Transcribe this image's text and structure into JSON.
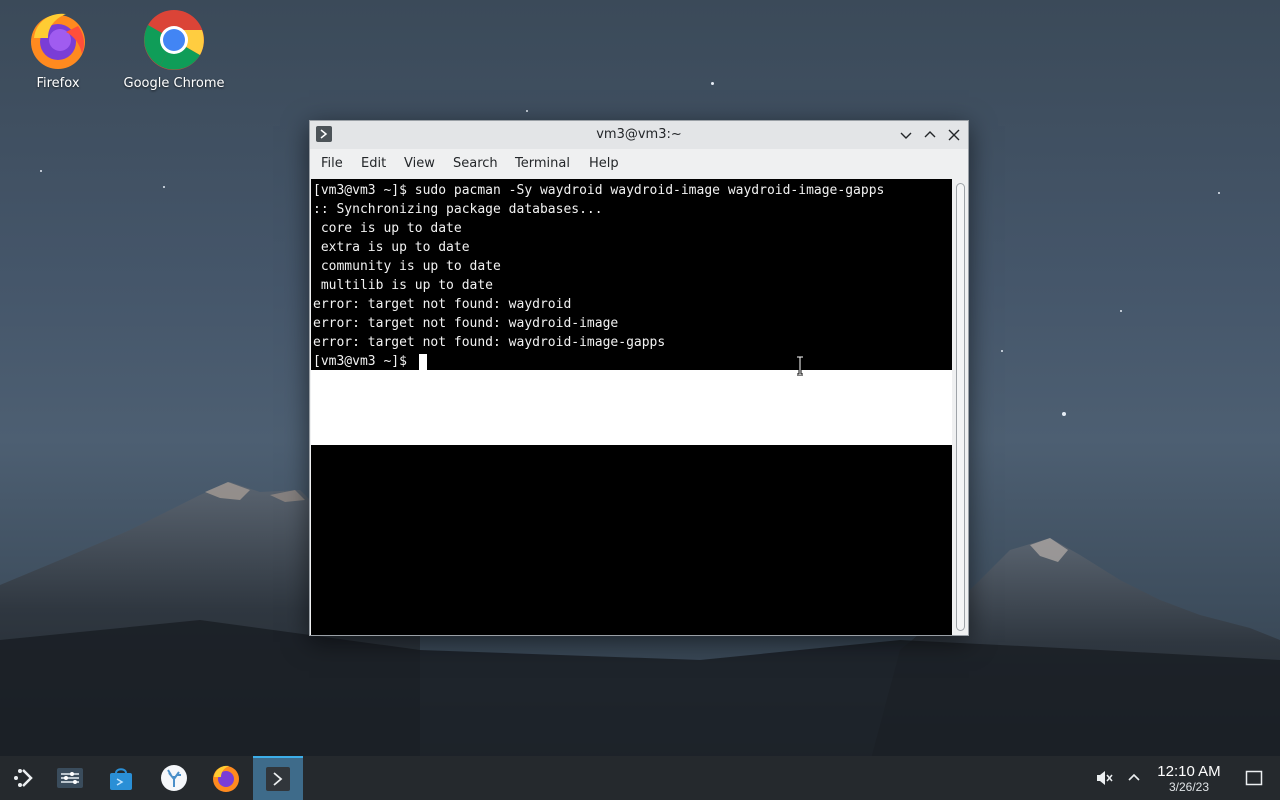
{
  "desktop": {
    "icons": [
      {
        "label": "Firefox"
      },
      {
        "label": "Google Chrome"
      }
    ]
  },
  "window": {
    "title": "vm3@vm3:~",
    "menu": [
      "File",
      "Edit",
      "View",
      "Search",
      "Terminal",
      "Help"
    ]
  },
  "terminal": {
    "lines": [
      "[vm3@vm3 ~]$ sudo pacman -Sy waydroid waydroid-image waydroid-image-gapps",
      ":: Synchronizing package databases...",
      " core is up to date",
      " extra is up to date",
      " community is up to date",
      " multilib is up to date",
      "error: target not found: waydroid",
      "error: target not found: waydroid-image",
      "error: target not found: waydroid-image-gapps",
      "[vm3@vm3 ~]$ "
    ]
  },
  "taskbar": {
    "time": "12:10 AM",
    "date": "3/26/23"
  },
  "colors": {
    "accent": "#3daee9",
    "taskbar": "#25292d",
    "terminal_bg": "#000000"
  }
}
